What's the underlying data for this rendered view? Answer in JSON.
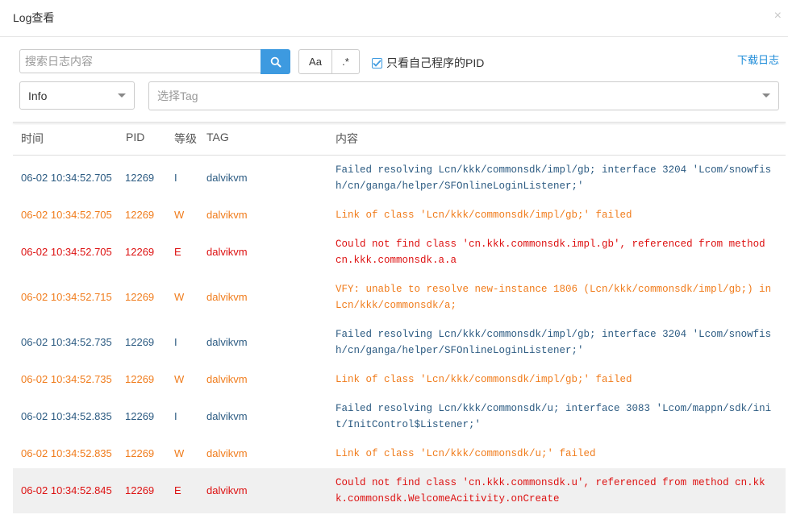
{
  "dialog": {
    "title": "Log查看",
    "close_icon": "×"
  },
  "toolbar": {
    "search_placeholder": "搜索日志内容",
    "case_label": "Aa",
    "regex_label": ".*",
    "own_pid_label": "只看自己程序的PID",
    "own_pid_checked": true,
    "download_label": "下载日志",
    "level_value": "Info",
    "tag_placeholder": "选择Tag"
  },
  "table": {
    "headers": {
      "time": "时间",
      "pid": "PID",
      "level": "等级",
      "tag": "TAG",
      "content": "内容"
    },
    "rows": [
      {
        "time": "06-02 10:34:52.705",
        "pid": "12269",
        "level": "I",
        "tag": "dalvikvm",
        "content": "Failed resolving Lcn/kkk/commonsdk/impl/gb; interface 3204 'Lcom/snowfish/cn/ganga/helper/SFOnlineLoginListener;'"
      },
      {
        "time": "06-02 10:34:52.705",
        "pid": "12269",
        "level": "W",
        "tag": "dalvikvm",
        "content": "Link of class 'Lcn/kkk/commonsdk/impl/gb;' failed"
      },
      {
        "time": "06-02 10:34:52.705",
        "pid": "12269",
        "level": "E",
        "tag": "dalvikvm",
        "content": "Could not find class 'cn.kkk.commonsdk.impl.gb', referenced from method cn.kkk.commonsdk.a.a"
      },
      {
        "time": "06-02 10:34:52.715",
        "pid": "12269",
        "level": "W",
        "tag": "dalvikvm",
        "content": "VFY: unable to resolve new-instance 1806 (Lcn/kkk/commonsdk/impl/gb;) in Lcn/kkk/commonsdk/a;"
      },
      {
        "time": "06-02 10:34:52.735",
        "pid": "12269",
        "level": "I",
        "tag": "dalvikvm",
        "content": "Failed resolving Lcn/kkk/commonsdk/impl/gb; interface 3204 'Lcom/snowfish/cn/ganga/helper/SFOnlineLoginListener;'"
      },
      {
        "time": "06-02 10:34:52.735",
        "pid": "12269",
        "level": "W",
        "tag": "dalvikvm",
        "content": "Link of class 'Lcn/kkk/commonsdk/impl/gb;' failed"
      },
      {
        "time": "06-02 10:34:52.835",
        "pid": "12269",
        "level": "I",
        "tag": "dalvikvm",
        "content": "Failed resolving Lcn/kkk/commonsdk/u; interface 3083 'Lcom/mappn/sdk/init/InitControl$Listener;'"
      },
      {
        "time": "06-02 10:34:52.835",
        "pid": "12269",
        "level": "W",
        "tag": "dalvikvm",
        "content": "Link of class 'Lcn/kkk/commonsdk/u;' failed"
      },
      {
        "time": "06-02 10:34:52.845",
        "pid": "12269",
        "level": "E",
        "tag": "dalvikvm",
        "content": "Could not find class 'cn.kkk.commonsdk.u', referenced from method cn.kkk.commonsdk.WelcomeAcitivity.onCreate"
      }
    ]
  },
  "colors": {
    "I": "#2c5b82",
    "W": "#f07c1c",
    "E": "#dd1111",
    "accent": "#3d9ae0",
    "link": "#1c8bd8"
  },
  "icons": {
    "search": "search-icon",
    "check": "check-icon",
    "caret": "caret-down-icon",
    "close": "close-icon"
  }
}
